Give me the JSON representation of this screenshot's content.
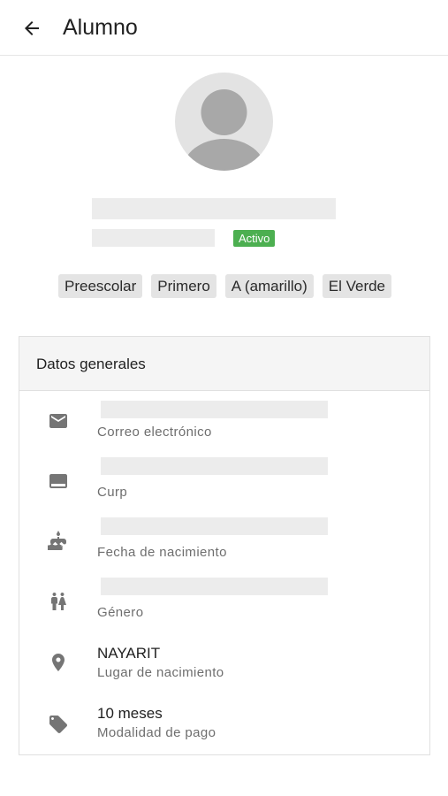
{
  "appbar": {
    "title": "Alumno",
    "back_icon": "arrow-back-icon"
  },
  "profile": {
    "avatar_icon": "default-person-avatar",
    "status_badge": "Activo",
    "status_color": "#4caf50"
  },
  "chips": [
    "Preescolar",
    "Primero",
    "A (amarillo)",
    "El Verde"
  ],
  "card": {
    "title": "Datos generales",
    "rows": [
      {
        "icon": "email-icon",
        "value": "",
        "label": "Correo electrónico"
      },
      {
        "icon": "id-card-icon",
        "value": "",
        "label": "Curp"
      },
      {
        "icon": "cake-icon",
        "value": "",
        "label": "Fecha de nacimiento"
      },
      {
        "icon": "gender-icon",
        "value": "",
        "label": "Género"
      },
      {
        "icon": "location-pin-icon",
        "value": "NAYARIT",
        "label": "Lugar de nacimiento"
      },
      {
        "icon": "tag-icon",
        "value": "10 meses",
        "label": "Modalidad de pago"
      }
    ]
  }
}
